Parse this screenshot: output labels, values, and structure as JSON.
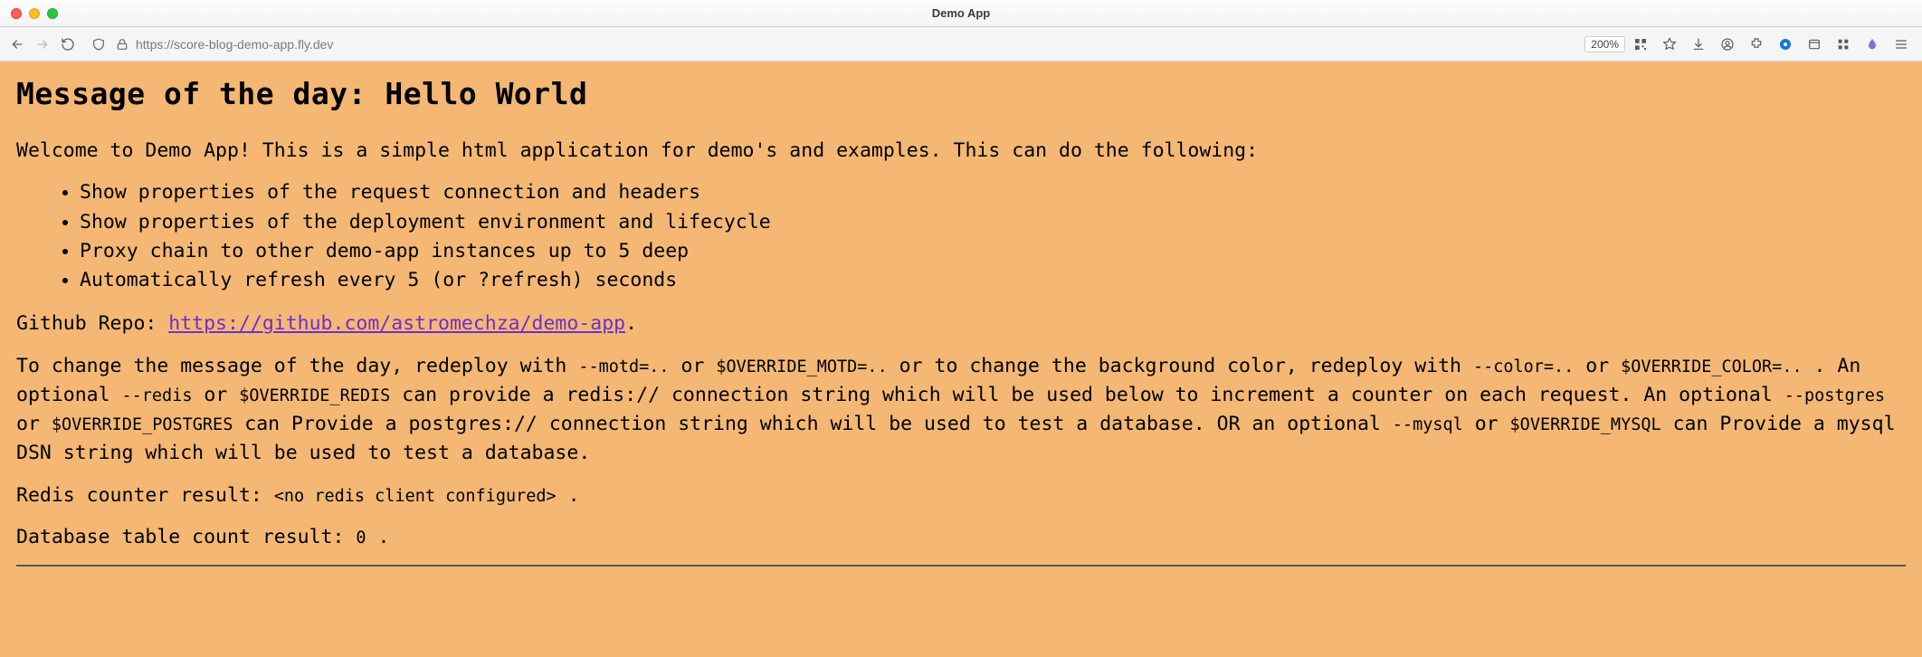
{
  "window": {
    "title": "Demo App"
  },
  "toolbar": {
    "zoom": "200%",
    "url": "https://score-blog-demo-app.fly.dev"
  },
  "page": {
    "heading_prefix": "Message of the day: ",
    "heading_motd": "Hello World",
    "intro": "Welcome to Demo App! This is a simple html application for demo's and examples. This can do the following:",
    "features": [
      "Show properties of the request connection and headers",
      "Show properties of the deployment environment and lifecycle",
      "Proxy chain to other demo-app instances up to 5 deep",
      "Automatically refresh every 5 (or ?refresh) seconds"
    ],
    "repo_label": "Github Repo: ",
    "repo_url_text": "https://github.com/astromechza/demo-app",
    "repo_period": ".",
    "config": {
      "t1": "To change the message of the day, redeploy with ",
      "c_motd": "--motd=..",
      "t2": " or ",
      "c_ovmotd": "$OVERRIDE_MOTD=..",
      "t3": " or to change the background color, redeploy with ",
      "c_color": "--color=..",
      "t4": " or ",
      "c_ovcolor": "$OVERRIDE_COLOR=..",
      "t5": " . An optional ",
      "c_redis": "--redis",
      "t6": " or ",
      "c_ovredis": "$OVERRIDE_REDIS",
      "t7": " can provide a redis:// connection string which will be used below to increment a counter on each request. An optional ",
      "c_postgres": "--postgres",
      "t8": " or ",
      "c_ovpostgres": "$OVERRIDE_POSTGRES",
      "t9": " can Provide a postgres:// connection string which will be used to test a database. OR an optional ",
      "c_mysql": "--mysql",
      "t10": " or ",
      "c_ovmysql": "$OVERRIDE_MYSQL",
      "t11": " can Provide a mysql DSN string which will be used to test a database."
    },
    "redis_label": "Redis counter result: ",
    "redis_value": "<no redis client configured>",
    "redis_period": " .",
    "db_label": "Database table count result: ",
    "db_value": "0",
    "db_period": " ."
  }
}
